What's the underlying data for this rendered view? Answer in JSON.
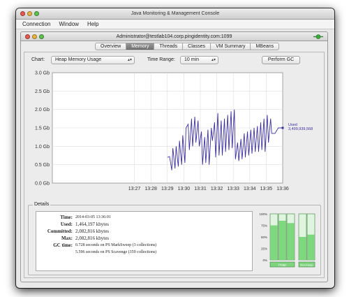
{
  "app": {
    "title": "Java Monitoring & Management Console",
    "menu": [
      "Connection",
      "Window",
      "Help"
    ],
    "connection_title": "Administrator@testlab104.corp.pingidentity.com:1099"
  },
  "tabs": [
    "Overview",
    "Memory",
    "Threads",
    "Classes",
    "VM Summary",
    "MBeans"
  ],
  "active_tab": "Memory",
  "controls": {
    "chart_label": "Chart:",
    "chart_value": "Heap Memory Usage",
    "range_label": "Time Range:",
    "range_value": "10 min",
    "gc_button": "Perform GC"
  },
  "chart_data": {
    "type": "line",
    "y_ticks": [
      "0.0 Gb",
      "0.5 Gb",
      "1.0 Gb",
      "1.5 Gb",
      "2.0 Gb",
      "2.5 Gb",
      "3.0 Gb"
    ],
    "x_ticks": [
      "13:27",
      "13:28",
      "13:29",
      "13:30",
      "13:31",
      "13:32",
      "13:33",
      "13:34",
      "13:35",
      "13:36"
    ],
    "ylim": [
      0,
      3.0
    ],
    "xlim": [
      13.367,
      13.6
    ],
    "grid": true,
    "series": [
      {
        "name": "Used",
        "color": "#3b2fa0",
        "x": [
          13.4833,
          13.4856,
          13.4878,
          13.4889,
          13.4911,
          13.4922,
          13.4944,
          13.4956,
          13.4978,
          13.4989,
          13.5011,
          13.5022,
          13.5044,
          13.5056,
          13.5078,
          13.5089,
          13.5111,
          13.5122,
          13.5144,
          13.5156,
          13.5178,
          13.5189,
          13.5211,
          13.5222,
          13.5244,
          13.5256,
          13.5278,
          13.5289,
          13.5311,
          13.5322,
          13.5344,
          13.5356,
          13.5378,
          13.5389,
          13.5411,
          13.5422,
          13.5444,
          13.5456,
          13.5478,
          13.5489,
          13.5511,
          13.5522,
          13.5544,
          13.5556,
          13.5578,
          13.5589,
          13.5611,
          13.5622,
          13.5644,
          13.5656,
          13.5678,
          13.5689,
          13.5711,
          13.5722,
          13.5744,
          13.5756,
          13.5778,
          13.5789,
          13.5811,
          13.5822,
          13.5844,
          13.5856,
          13.5878,
          13.5889,
          13.5922,
          13.5956,
          13.6
        ],
        "y": [
          0.7,
          0.72,
          0.35,
          0.95,
          0.4,
          1.0,
          0.45,
          1.15,
          0.5,
          1.3,
          0.55,
          1.5,
          1.6,
          0.9,
          1.75,
          1.0,
          1.8,
          1.1,
          1.7,
          1.0,
          1.4,
          0.5,
          1.25,
          0.55,
          1.45,
          0.5,
          1.5,
          1.15,
          1.65,
          0.7,
          1.9,
          0.75,
          1.7,
          0.75,
          1.75,
          0.85,
          1.85,
          0.9,
          1.95,
          0.95,
          2.0,
          0.65,
          1.1,
          0.6,
          1.2,
          0.65,
          1.35,
          0.7,
          1.4,
          0.75,
          1.45,
          0.8,
          1.5,
          0.85,
          1.55,
          0.85,
          1.65,
          0.9,
          1.75,
          0.85,
          1.85,
          1.1,
          1.75,
          1.35,
          1.35,
          1.5,
          1.5
        ],
        "last_value": "3,499,939,568"
      }
    ]
  },
  "details": {
    "title": "Details",
    "time_label": "Time:",
    "time_value": "2014-03-05 13:36:01",
    "used_label": "Used:",
    "used_value": "1,464,197 kbytes",
    "committed_label": "Committed:",
    "committed_value": "2,082,816 kbytes",
    "max_label": "Max:",
    "max_value": "2,082,816 kbytes",
    "gc_label": "GC time:",
    "gc1_value": "0.728 seconds on PS MarkSweep (3 collections)",
    "gc2_value": "5.596 seconds on PS Scavenge (359 collections)"
  },
  "memory_bars": {
    "ticks": [
      "100%",
      "75%",
      "50%",
      "25%",
      "0%"
    ],
    "heap_label": "Heap",
    "nonheap_label": "Non-Heap",
    "heap_levels": [
      0.75,
      0.85,
      0.8
    ],
    "nonheap_levels": [
      0.5,
      0.55
    ]
  }
}
